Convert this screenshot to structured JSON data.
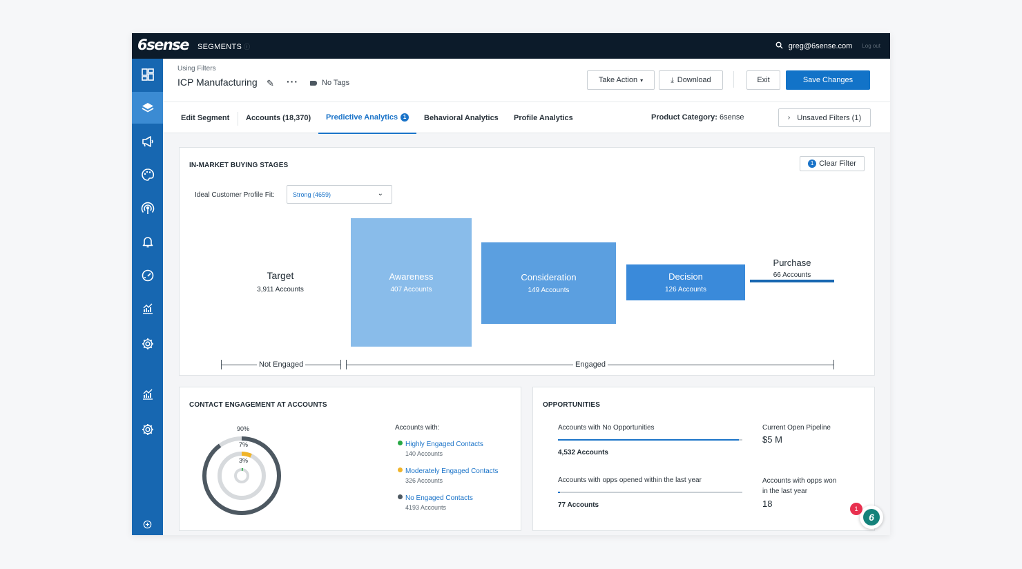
{
  "topbar": {
    "logo": "6sense",
    "section": "SEGMENTS",
    "user_email": "greg@6sense.com",
    "logout": "Log out"
  },
  "header": {
    "using": "Using Filters",
    "title": "ICP Manufacturing",
    "tags": "No Tags",
    "take_action": "Take Action",
    "download": "Download",
    "exit": "Exit",
    "save": "Save Changes"
  },
  "tabs": [
    {
      "label": "Edit Segment"
    },
    {
      "label": "Accounts (18,370)"
    },
    {
      "label": "Predictive Analytics",
      "badge": "1"
    },
    {
      "label": "Behavioral Analytics"
    },
    {
      "label": "Profile Analytics"
    }
  ],
  "product_category": {
    "label": "Product Category:",
    "value": "6sense"
  },
  "unsaved_filters": "Unsaved Filters (1)",
  "buying_stages": {
    "title": "IN-MARKET BUYING STAGES",
    "clear_filter_badge": "1",
    "clear_filter": "Clear Filter",
    "fit_label": "Ideal Customer Profile Fit:",
    "fit_value": "Strong (4659)",
    "stages": [
      {
        "name": "Target",
        "count": "3,911 Accounts"
      },
      {
        "name": "Awareness",
        "count": "407 Accounts",
        "color": "#89bcea"
      },
      {
        "name": "Consideration",
        "count": "149 Accounts",
        "color": "#5b9fe0"
      },
      {
        "name": "Decision",
        "count": "126 Accounts",
        "color": "#3a8ada"
      },
      {
        "name": "Purchase",
        "count": "66 Accounts",
        "color": "#1767b1"
      }
    ],
    "not_engaged": "Not Engaged",
    "engaged": "Engaged"
  },
  "contact_engagement": {
    "title": "CONTACT ENGAGEMENT AT ACCOUNTS",
    "accounts_with": "Accounts with:",
    "rings": [
      {
        "pct": "90%",
        "value": 0.9,
        "color": "#4d5861"
      },
      {
        "pct": "7%",
        "value": 0.07,
        "color": "#f0b429"
      },
      {
        "pct": "3%",
        "value": 0.03,
        "color": "#27a844"
      }
    ],
    "legend": [
      {
        "label": "Highly Engaged Contacts",
        "count": "140 Accounts",
        "color": "#27a844"
      },
      {
        "label": "Moderately Engaged Contacts",
        "count": "326 Accounts",
        "color": "#f0b429"
      },
      {
        "label": "No Engaged Contacts",
        "count": "4193 Accounts",
        "color": "#4d5861"
      }
    ]
  },
  "opportunities": {
    "title": "OPPORTUNITIES",
    "no_opps_label": "Accounts with No Opportunities",
    "no_opps_value": "4,532 Accounts",
    "no_opps_fill": 0.98,
    "opened_label": "Accounts with opps opened within the last year",
    "opened_value": "77 Accounts",
    "opened_fill": 0.01,
    "pipeline_label": "Current Open Pipeline",
    "pipeline_value": "$5 M",
    "won_label_1": "Accounts with opps won",
    "won_label_2": "in the last year",
    "won_value": "18"
  },
  "chat": {
    "badge": "1",
    "icon": "6sense-chat-icon"
  }
}
